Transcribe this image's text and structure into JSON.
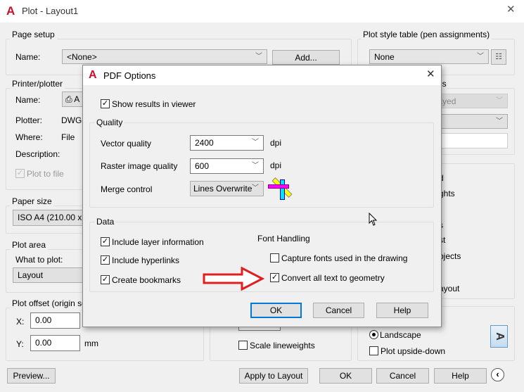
{
  "window": {
    "title": "Plot - Layout1",
    "close": "✕"
  },
  "page_setup": {
    "label": "Page setup",
    "name_label": "Name:",
    "name_value": "<None>",
    "add_button": "Add..."
  },
  "plot_style": {
    "label": "Plot style table (pen assignments)",
    "value": "None"
  },
  "printer": {
    "label": "Printer/plotter",
    "name_label": "Name:",
    "name_value": "A",
    "plotter_label": "Plotter:",
    "plotter_value": "DWG T",
    "where_label": "Where:",
    "where_value": "File",
    "description_label": "Description:",
    "plot_to_file": "Plot to file"
  },
  "paper_size": {
    "label": "Paper size",
    "value": "ISO A4 (210.00 x 2"
  },
  "plot_area": {
    "label": "Plot area",
    "what_label": "What to plot:",
    "what_value": "Layout"
  },
  "plot_offset": {
    "label": "Plot offset (origin set",
    "x_label": "X:",
    "x_value": "0.00",
    "y_label": "Y:",
    "y_value": "0.00",
    "unit": "mm"
  },
  "shaded": {
    "label_fragment": "ns",
    "combo1": "splayed",
    "combo2": "al"
  },
  "plot_options": {
    "items": [
      "d",
      "ghts",
      "s",
      "st",
      "bjects",
      "ayout"
    ]
  },
  "scale": {
    "scale_lineweights": "Scale lineweights"
  },
  "orientation": {
    "landscape": "Landscape",
    "upside_down": "Plot upside-down",
    "icon_letter": "A"
  },
  "footer": {
    "preview": "Preview...",
    "apply": "Apply to Layout",
    "ok": "OK",
    "cancel": "Cancel",
    "help": "Help"
  },
  "pdf": {
    "title": "PDF Options",
    "close": "✕",
    "show_results": "Show results in viewer",
    "quality_label": "Quality",
    "vector_label": "Vector quality",
    "vector_value": "2400",
    "raster_label": "Raster image quality",
    "raster_value": "600",
    "dpi": "dpi",
    "merge_label": "Merge control",
    "merge_value": "Lines Overwrite",
    "data_label": "Data",
    "layer_info": "Include layer information",
    "hyperlinks": "Include hyperlinks",
    "bookmarks": "Create bookmarks",
    "font_label": "Font Handling",
    "capture_fonts": "Capture fonts used in the drawing",
    "convert_text": "Convert all text to geometry",
    "ok": "OK",
    "cancel": "Cancel",
    "help": "Help"
  },
  "colors": {
    "accent": "#0078d7",
    "autocad_red": "#c8102e",
    "arrow": "#e02020"
  }
}
